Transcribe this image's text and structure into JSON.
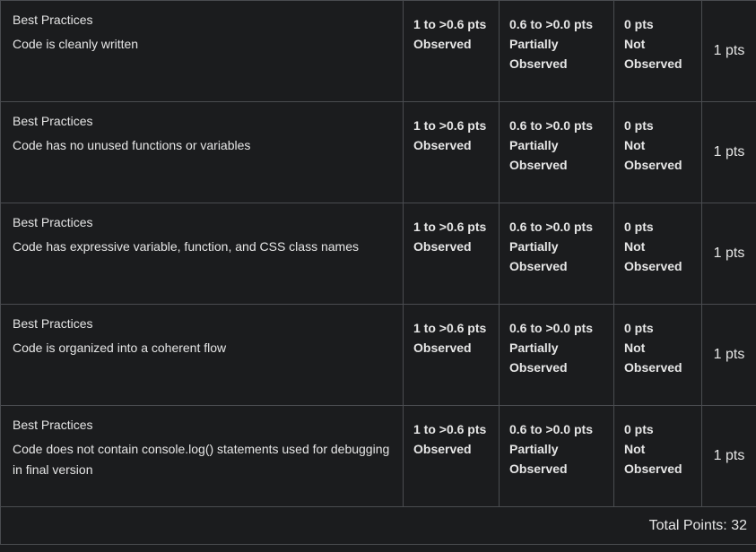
{
  "criteria": [
    {
      "title": "Best Practices",
      "description": "Code is cleanly written",
      "ratings": [
        {
          "points": "1 to >0.6 pts",
          "label": "Observed"
        },
        {
          "points": "0.6 to >0.0 pts",
          "label": "Partially\nObserved"
        },
        {
          "points": "0 pts",
          "label": "Not\nObserved"
        }
      ],
      "points": "1 pts"
    },
    {
      "title": "Best Practices",
      "description": "Code has no unused functions or variables",
      "ratings": [
        {
          "points": "1 to >0.6 pts",
          "label": "Observed"
        },
        {
          "points": "0.6 to >0.0 pts",
          "label": "Partially\nObserved"
        },
        {
          "points": "0 pts",
          "label": "Not\nObserved"
        }
      ],
      "points": "1 pts"
    },
    {
      "title": "Best Practices",
      "description": "Code has expressive variable, function, and CSS class names",
      "ratings": [
        {
          "points": "1 to >0.6 pts",
          "label": "Observed"
        },
        {
          "points": "0.6 to >0.0 pts",
          "label": "Partially\nObserved"
        },
        {
          "points": "0 pts",
          "label": "Not\nObserved"
        }
      ],
      "points": "1 pts"
    },
    {
      "title": "Best Practices",
      "description": "Code is organized into a coherent flow",
      "ratings": [
        {
          "points": "1 to >0.6 pts",
          "label": "Observed"
        },
        {
          "points": "0.6 to >0.0 pts",
          "label": "Partially\nObserved"
        },
        {
          "points": "0 pts",
          "label": "Not\nObserved"
        }
      ],
      "points": "1 pts"
    },
    {
      "title": "Best Practices",
      "description": "Code does not contain console.log() statements used for debugging in final version",
      "ratings": [
        {
          "points": "1 to >0.6 pts",
          "label": "Observed"
        },
        {
          "points": "0.6 to >0.0 pts",
          "label": "Partially\nObserved"
        },
        {
          "points": "0 pts",
          "label": "Not\nObserved"
        }
      ],
      "points": "1 pts"
    }
  ],
  "total": "Total Points: 32",
  "colors": {
    "background": "#1b1c1e",
    "border": "#4a4c50",
    "text": "#e6e6e6"
  }
}
